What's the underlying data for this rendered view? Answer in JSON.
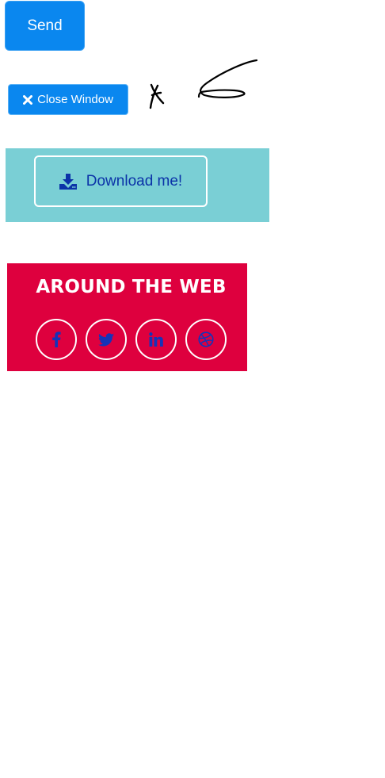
{
  "send_button": {
    "label": "Send"
  },
  "close_button": {
    "label": "Close Window",
    "icon": "times-icon"
  },
  "signature": {
    "description_icon": "handwritten-signature"
  },
  "download": {
    "label": "Download me!",
    "icon": "download-icon"
  },
  "around_the_web": {
    "title": "AROUND THE WEB",
    "links": [
      {
        "icon": "facebook-icon"
      },
      {
        "icon": "twitter-icon"
      },
      {
        "icon": "linkedin-icon"
      },
      {
        "icon": "dribbble-icon"
      }
    ]
  },
  "colors": {
    "primary_blue": "#0a87ef",
    "teal_panel": "#7acfd5",
    "red_panel": "#de003e",
    "icon_blue": "#1533b8"
  }
}
